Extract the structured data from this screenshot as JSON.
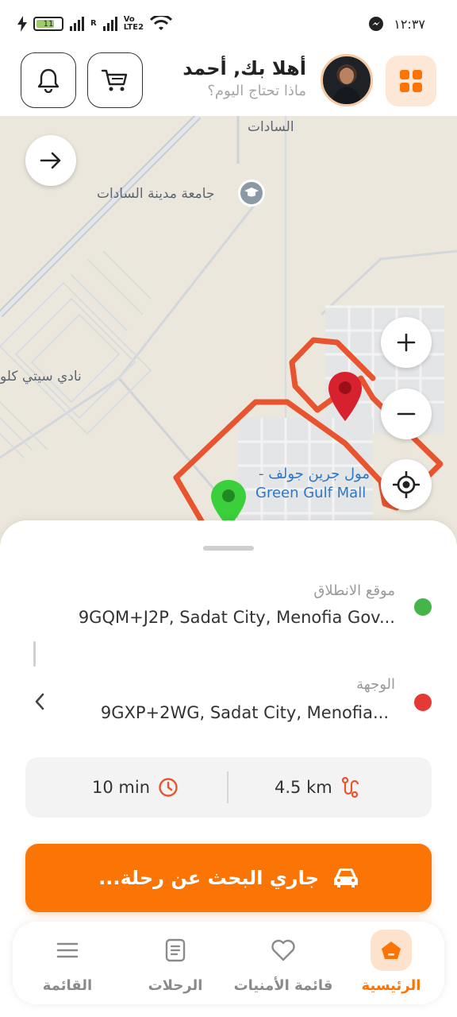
{
  "status_bar": {
    "time": "١٢:٣٧",
    "battery": "11",
    "network_label_top": "Vo",
    "network_label_bottom": "LTE2",
    "roaming": "R"
  },
  "header": {
    "greeting": "أهلا بك, أحمد",
    "subtitle": "ماذا تحتاج اليوم؟",
    "grid_icon": "grid-icon",
    "cart_icon": "cart-icon",
    "bell_icon": "bell-icon"
  },
  "map": {
    "labels": {
      "sadat": "السادات",
      "university": "جامعة مدينة السادات",
      "club": "نادي سيتي كلو",
      "mall_ar": "مول جرين جولف -",
      "mall_en": "Green Gulf Mall"
    },
    "route_color": "#e8542f",
    "pickup_pin_color": "#3bcf3b",
    "dest_pin_color": "#d8212e"
  },
  "trip": {
    "pickup_label": "موقع الانطلاق",
    "pickup_value": "9GQM+J2P, Sadat City, Menofia Gov...",
    "dest_label": "الوجهة",
    "dest_value": "9GXP+2WG, Sadat City, Menofia...",
    "pickup_dot_color": "#43b549",
    "dest_dot_color": "#e53935",
    "duration": "10 min",
    "distance": "4.5 km",
    "search_button": "جاري البحث عن رحلة..."
  },
  "nav": {
    "items": [
      {
        "label": "الرئيسية",
        "icon": "home-icon",
        "active": true
      },
      {
        "label": "قائمة الأمنيات",
        "icon": "heart-icon",
        "active": false
      },
      {
        "label": "الرحلات",
        "icon": "document-icon",
        "active": false
      },
      {
        "label": "القائمة",
        "icon": "menu-icon",
        "active": false
      }
    ]
  },
  "accent_color": "#fb7406"
}
